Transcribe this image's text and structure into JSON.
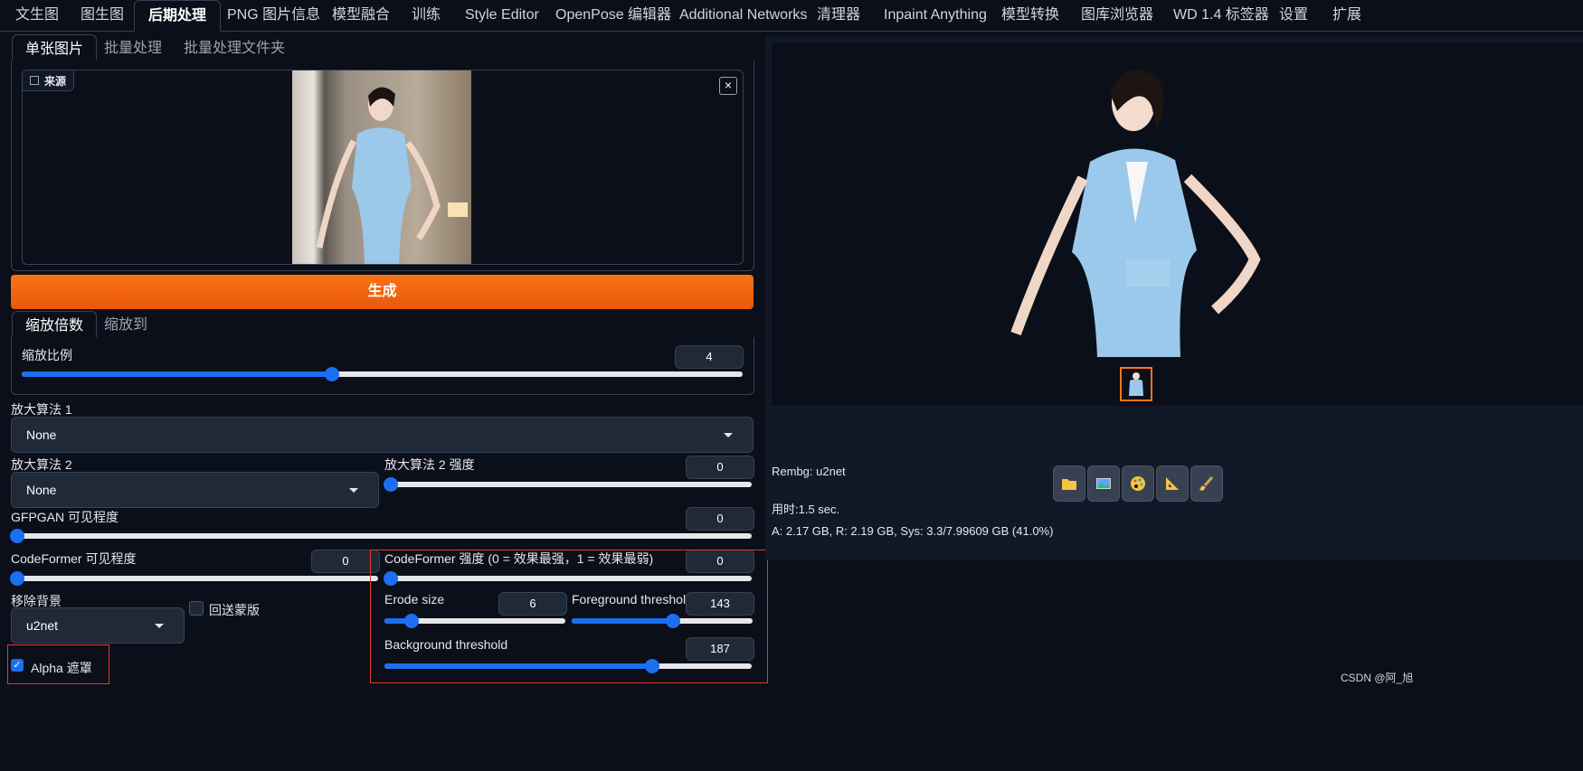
{
  "top_tabs": [
    "文生图",
    "图生图",
    "后期处理",
    "PNG 图片信息",
    "模型融合",
    "训练",
    "Style Editor",
    "OpenPose 编辑器",
    "Additional Networks",
    "清理器",
    "Inpaint Anything",
    "模型转换",
    "图库浏览器",
    "WD 1.4 标签器",
    "设置",
    "扩展"
  ],
  "sub_tabs": [
    "单张图片",
    "批量处理",
    "批量处理文件夹"
  ],
  "source": {
    "label": "来源",
    "close": "×"
  },
  "generate_label": "生成",
  "scale_tabs": [
    "缩放倍数",
    "缩放到"
  ],
  "scale": {
    "label": "缩放比例",
    "value": "4",
    "fraction": 0.43
  },
  "upscaler1": {
    "label": "放大算法 1",
    "value": "None"
  },
  "upscaler2": {
    "label": "放大算法 2",
    "value": "None",
    "strength_label": "放大算法 2 强度",
    "strength": "0",
    "fraction": 0
  },
  "gfpgan": {
    "label": "GFPGAN 可见程度",
    "value": "0",
    "fraction": 0
  },
  "codeformer_visibility": {
    "label": "CodeFormer 可见程度",
    "value": "0",
    "fraction": 0
  },
  "codeformer_weight": {
    "label": "CodeFormer 强度 (0 = 效果最强，1 = 效果最弱)",
    "value": "0",
    "fraction": 0
  },
  "rembg": {
    "label": "移除背景",
    "model": "u2net",
    "return_mask_label": "回送蒙版",
    "return_mask": false,
    "alpha_label": "Alpha 遮罩",
    "alpha": true
  },
  "erode": {
    "label": "Erode size",
    "value": "6",
    "fraction": 0.15
  },
  "fg": {
    "label": "Foreground threshold",
    "value": "143",
    "fraction": 0.56
  },
  "bg": {
    "label": "Background threshold",
    "value": "187",
    "fraction": 0.73
  },
  "output": {
    "info1": "Rembg: u2net",
    "info2": "用时:1.5 sec.",
    "info3": "A: 2.17 GB, R: 2.19 GB, Sys: 3.3/7.99609 GB (41.0%)"
  },
  "tool_icons": [
    "folder-icon",
    "image-icon",
    "palette-icon",
    "ruler-icon",
    "brush-icon"
  ],
  "watermark": "CSDN @阿_旭",
  "colors": {
    "accent": "#1d6ff2",
    "generate": "#f97316",
    "highlight_box": "#e53935",
    "background": "#0b0f19"
  }
}
